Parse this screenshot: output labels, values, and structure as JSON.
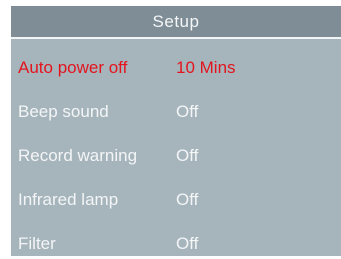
{
  "header": {
    "title": "Setup"
  },
  "colors": {
    "background": "#a6b5bc",
    "header": "#7f8e96",
    "selected_text": "#e3141e",
    "text": "#f3f5f6"
  },
  "menu": {
    "selected_index": 0,
    "items": [
      {
        "label": "Auto power off",
        "value": "10 Mins"
      },
      {
        "label": "Beep sound",
        "value": "Off"
      },
      {
        "label": "Record warning",
        "value": "Off"
      },
      {
        "label": "Infrared lamp",
        "value": "Off"
      },
      {
        "label": "Filter",
        "value": "Off"
      }
    ]
  }
}
